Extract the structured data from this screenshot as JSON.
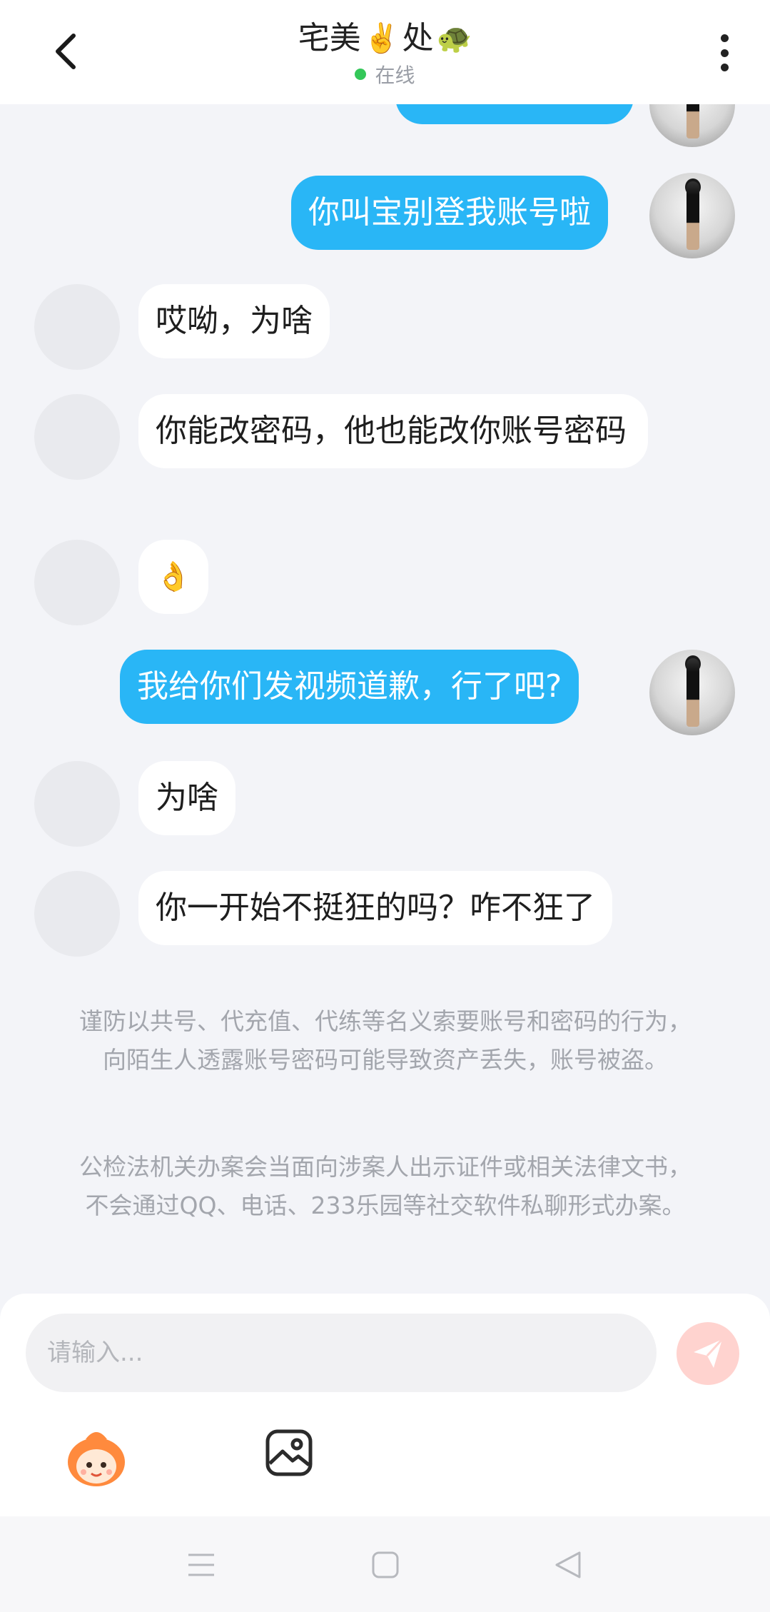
{
  "header": {
    "title_text": "宅美",
    "title_emoji_1": "✌️",
    "title_text_2": "处",
    "title_emoji_2": "🐢",
    "status": "在线"
  },
  "messages": [
    {
      "side": "right",
      "text": "你叫宝别登我账号啦"
    },
    {
      "side": "left",
      "text": "哎呦，为啥"
    },
    {
      "side": "left",
      "text": "你能改密码，他也能改你账号密码"
    },
    {
      "side": "left",
      "text": "👌"
    },
    {
      "side": "right",
      "text": "我给你们发视频道歉，行了吧?"
    },
    {
      "side": "left",
      "text": "为啥"
    },
    {
      "side": "left",
      "text": "你一开始不挺狂的吗？咋不狂了"
    }
  ],
  "notices": [
    "谨防以共号、代充值、代练等名义索要账号和密码的行为，向陌生人透露账号密码可能导致资产丢失，账号被盗。",
    "公检法机关办案会当面向涉案人出示证件或相关法律文书，不会通过QQ、电话、233乐园等社交软件私聊形式办案。"
  ],
  "input": {
    "placeholder": "请输入..."
  },
  "colors": {
    "accent": "#29b6f6",
    "online": "#34c759",
    "send_button": "#ffd3cf"
  }
}
